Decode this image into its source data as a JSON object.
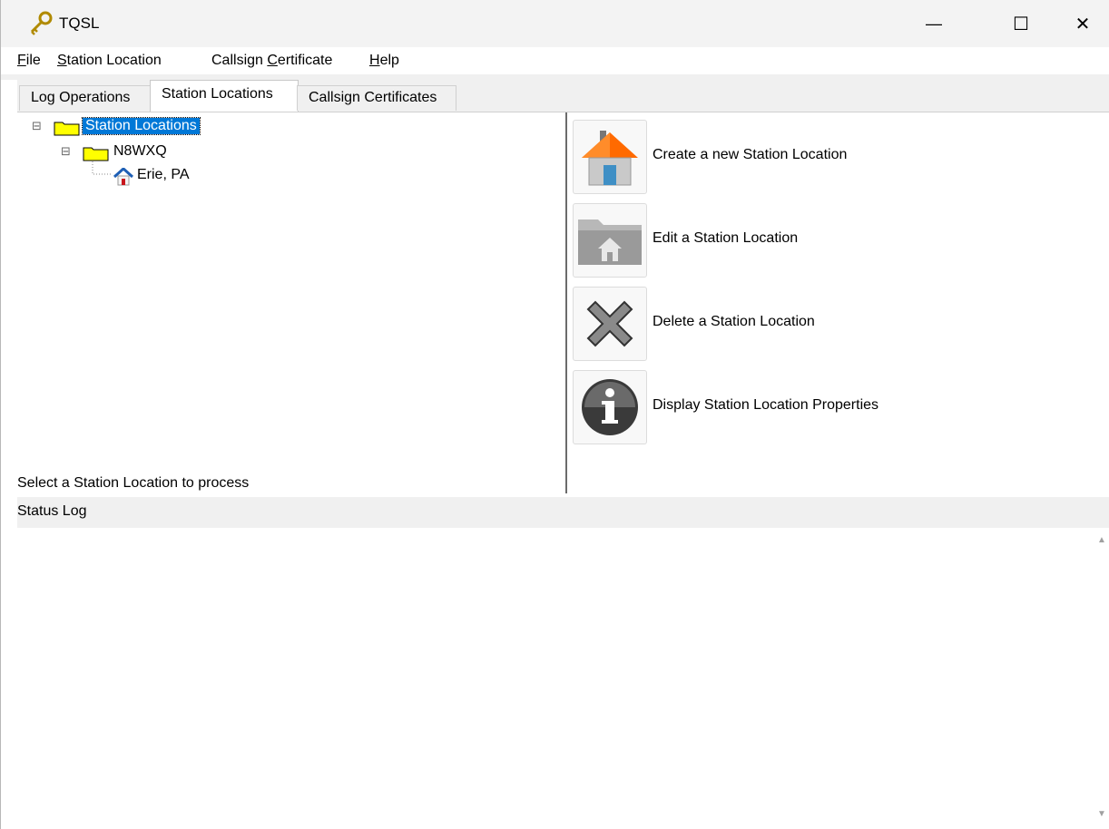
{
  "window": {
    "title": "TQSL",
    "controls": {
      "minimize": "—",
      "maximize": "☐",
      "close": "✕"
    }
  },
  "menu": [
    {
      "key": "file",
      "underline": "F",
      "rest": "ile"
    },
    {
      "key": "station_location",
      "underline": "S",
      "rest": "tation Location"
    },
    {
      "key": "callsign_certificate",
      "pre": "Callsign ",
      "underline": "C",
      "rest": "ertificate"
    },
    {
      "key": "help",
      "underline": "H",
      "rest": "elp"
    }
  ],
  "tabs": [
    {
      "label": "Log Operations",
      "active": false
    },
    {
      "label": "Station Locations",
      "active": true
    },
    {
      "label": "Callsign Certificates",
      "active": false
    }
  ],
  "tree": {
    "root": "Station Locations",
    "callsign": "N8WXQ",
    "location": "Erie, PA",
    "expander": "⊟"
  },
  "prompt": "Select a Station Location to process",
  "actions": [
    {
      "label": "Create a new Station Location",
      "icon": "house-icon"
    },
    {
      "label": "Edit a Station Location",
      "icon": "folder-house-icon"
    },
    {
      "label": "Delete a Station Location",
      "icon": "x-icon"
    },
    {
      "label": "Display Station Location Properties",
      "icon": "info-icon"
    }
  ],
  "status_log": {
    "title": "Status Log",
    "scroll_up": "▲",
    "scroll_down": "▼"
  }
}
